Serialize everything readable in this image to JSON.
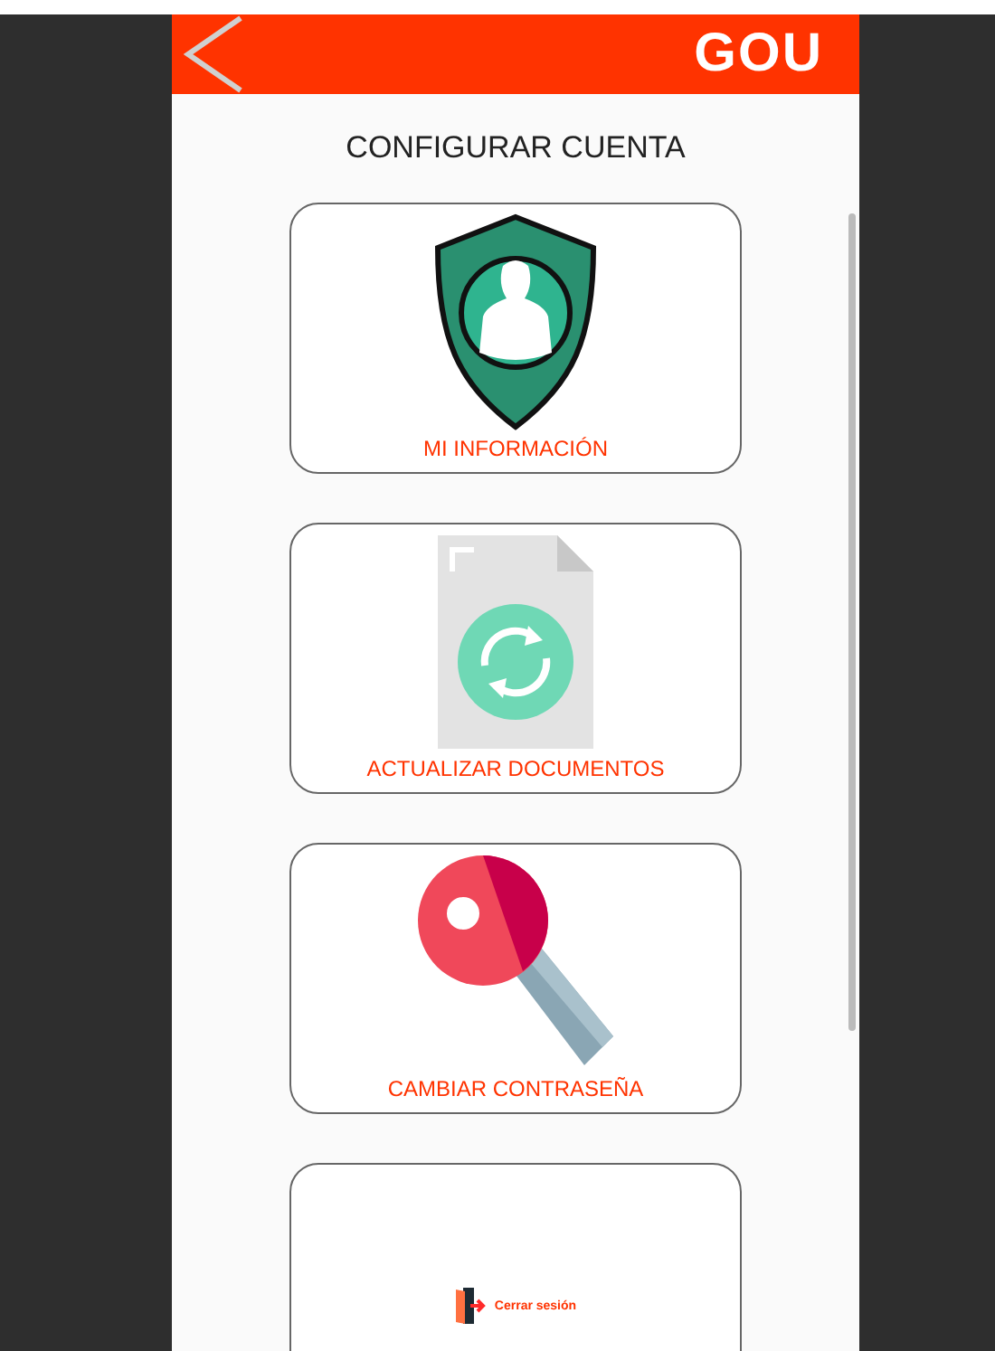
{
  "header": {
    "logo": "GOU"
  },
  "title": "CONFIGURAR CUENTA",
  "cards": [
    {
      "kind": "shield",
      "label": "MI INFORMACIÓN"
    },
    {
      "kind": "document",
      "label": "ACTUALIZAR DOCUMENTOS"
    },
    {
      "kind": "key",
      "label": "CAMBIAR CONTRASEÑA"
    },
    {
      "kind": "logout",
      "label": "Cerrar sesión"
    }
  ]
}
